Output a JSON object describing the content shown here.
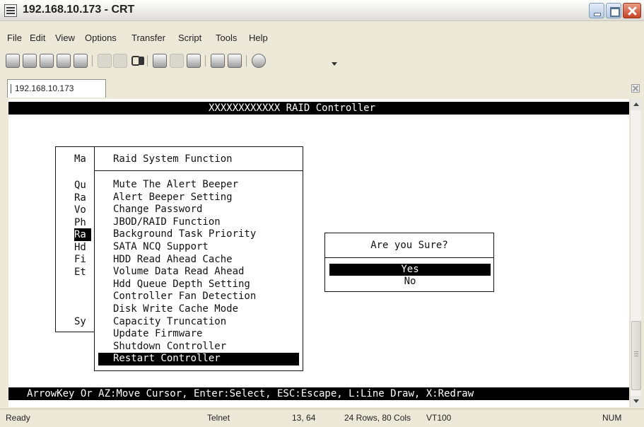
{
  "window": {
    "title": "192.168.10.173 - CRT"
  },
  "menubar": {
    "items": [
      "File",
      "Edit",
      "View",
      "Options",
      "Transfer",
      "Script",
      "Tools",
      "Help"
    ]
  },
  "tab": {
    "label": "192.168.10.173"
  },
  "terminal": {
    "header": "XXXXXXXXXXXX RAID Controller",
    "main_menu": {
      "title": "Ma",
      "items": [
        "Qu",
        "Ra",
        "Vo",
        "Ph",
        "Ra",
        "Hd",
        "Fi",
        "Et",
        "Sy"
      ],
      "selected_index": 4
    },
    "raid_system_function": {
      "title": "Raid System Function",
      "items": [
        "Mute The Alert Beeper",
        "Alert Beeper Setting",
        "Change Password",
        "JBOD/RAID Function",
        "Background Task Priority",
        "SATA NCQ Support",
        "HDD Read Ahead Cache",
        "Volume Data Read Ahead",
        "Hdd Queue Depth Setting",
        "Controller Fan Detection",
        "Disk Write Cache Mode",
        "Capacity Truncation",
        "Update Firmware",
        "Shutdown Controller",
        "Restart Controller"
      ],
      "selected_index": 14
    },
    "confirm": {
      "title": "Are you Sure?",
      "options": [
        "Yes",
        "No"
      ],
      "selected_index": 0
    },
    "help_line": "ArrowKey Or AZ:Move Cursor, Enter:Select, ESC:Escape, L:Line Draw, X:Redraw"
  },
  "statusbar": {
    "ready": "Ready",
    "protocol": "Telnet",
    "cursor_pos": "13, 64",
    "size": "24 Rows, 80 Cols",
    "emulation": "VT100",
    "num": "NUM"
  },
  "toolbar": {
    "icons": [
      "connect-icon",
      "quick-connect-icon",
      "connect-in-tab-icon",
      "reconnect-icon",
      "disconnect-icon",
      "copy-icon",
      "paste-icon",
      "find-icon",
      "session-options-icon",
      "log-session-icon",
      "print-icon",
      "sftp-icon",
      "keymap-icon",
      "help-icon"
    ]
  }
}
